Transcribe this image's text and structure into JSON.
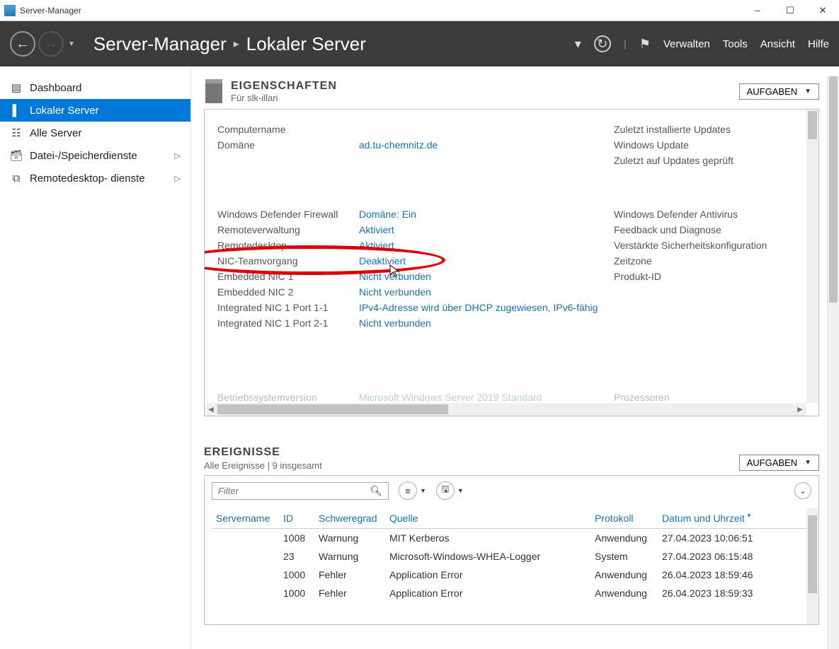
{
  "window": {
    "title": "Server-Manager"
  },
  "header": {
    "breadcrumb_root": "Server-Manager",
    "breadcrumb_current": "Lokaler Server",
    "menu": {
      "verwalten": "Verwalten",
      "tools": "Tools",
      "ansicht": "Ansicht",
      "hilfe": "Hilfe"
    }
  },
  "sidebar": {
    "items": [
      {
        "label": "Dashboard"
      },
      {
        "label": "Lokaler Server"
      },
      {
        "label": "Alle Server"
      },
      {
        "label": "Datei-/Speicherdienste"
      },
      {
        "label": "Remotedesktop- dienste"
      }
    ]
  },
  "properties": {
    "title": "EIGENSCHAFTEN",
    "subtitle": "Für slk-illari",
    "tasks_label": "AUFGABEN",
    "rows1": [
      {
        "k": "Computername",
        "v": " ",
        "r": "Zuletzt installierte Updates",
        "blur": true
      },
      {
        "k": "Domäne",
        "v": "ad.tu-chemnitz.de",
        "r": "Windows Update"
      },
      {
        "k": "",
        "v": "",
        "r": "Zuletzt auf Updates geprüft"
      }
    ],
    "rows2": [
      {
        "k": "Windows Defender Firewall",
        "v": "Domäne: Ein",
        "r": "Windows Defender Antivirus"
      },
      {
        "k": "Remoteverwaltung",
        "v": "Aktiviert",
        "r": "Feedback und Diagnose"
      },
      {
        "k": "Remotedesktop",
        "v": "Aktiviert",
        "r": "Verstärkte Sicherheitskonfiguration"
      },
      {
        "k": "NIC-Teamvorgang",
        "v": "Deaktiviert",
        "r": "Zeitzone"
      },
      {
        "k": "Embedded NIC 1",
        "v": "Nicht verbunden",
        "r": "Produkt-ID"
      },
      {
        "k": "Embedded NIC 2",
        "v": "Nicht verbunden",
        "r": ""
      },
      {
        "k": "Integrated NIC 1 Port 1-1",
        "v": "IPv4-Adresse wird über DHCP zugewiesen, IPv6-fähig",
        "r": ""
      },
      {
        "k": "Integrated NIC 1 Port 2-1",
        "v": "Nicht verbunden",
        "r": ""
      }
    ],
    "partial": {
      "k": "Betriebssystemversion",
      "v": "Microsoft Windows Server 2019 Standard",
      "r": "Prozessoren"
    }
  },
  "events": {
    "title": "EREIGNISSE",
    "subtitle": "Alle Ereignisse | 9 insgesamt",
    "tasks_label": "AUFGABEN",
    "filter_placeholder": "Filter",
    "columns": {
      "server": "Servername",
      "id": "ID",
      "severity": "Schweregrad",
      "source": "Quelle",
      "protocol": "Protokoll",
      "datetime": "Datum und Uhrzeit"
    },
    "rows": [
      {
        "server": " ",
        "id": "1008",
        "severity": "Warnung",
        "source": "MIT Kerberos",
        "protocol": "Anwendung",
        "datetime": "27.04.2023 10:06:51"
      },
      {
        "server": " ",
        "id": "23",
        "severity": "Warnung",
        "source": "Microsoft-Windows-WHEA-Logger",
        "protocol": "System",
        "datetime": "27.04.2023 06:15:48"
      },
      {
        "server": " ",
        "id": "1000",
        "severity": "Fehler",
        "source": "Application Error",
        "protocol": "Anwendung",
        "datetime": "26.04.2023 18:59:46"
      },
      {
        "server": " ",
        "id": "1000",
        "severity": "Fehler",
        "source": "Application Error",
        "protocol": "Anwendung",
        "datetime": "26.04.2023 18:59:33"
      }
    ]
  }
}
